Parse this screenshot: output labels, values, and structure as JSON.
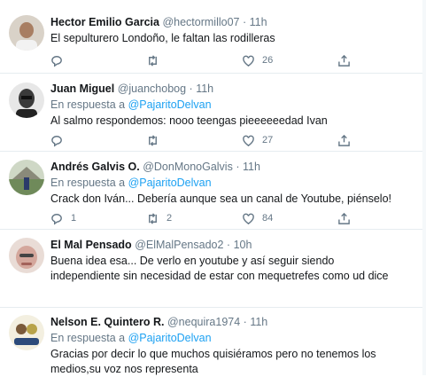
{
  "tweets": [
    {
      "name": "Hector Emilio Garcia",
      "handle": "@hectormillo07",
      "time": "11h",
      "reply_prefix": "",
      "reply_to": "",
      "text": "El sepulturero Londoño, le faltan las rodilleras",
      "replies": "",
      "retweets": "",
      "likes": "26",
      "avatar_color": "#8a7b6a"
    },
    {
      "name": "Juan Miguel",
      "handle": "@juanchobog",
      "time": "11h",
      "reply_prefix": "En respuesta a",
      "reply_to": "@PajaritoDelvan",
      "text": "Al salmo respondemos: nooo teengas pieeeeeedad Ivan",
      "replies": "",
      "retweets": "",
      "likes": "27",
      "avatar_color": "#2b2b2b"
    },
    {
      "name": "Andrés Galvis O.",
      "handle": "@DonMonoGalvis",
      "time": "11h",
      "reply_prefix": "En respuesta a",
      "reply_to": "@PajaritoDelvan",
      "text": "Crack don Iván... Debería aunque sea un canal de Youtube, piénselo!",
      "replies": "1",
      "retweets": "2",
      "likes": "84",
      "avatar_color": "#6f8a5a"
    },
    {
      "name": "El Mal Pensado",
      "handle": "@ElMalPensado2",
      "time": "10h",
      "reply_prefix": "",
      "reply_to": "",
      "text": "Buena idea esa... De verlo en youtube y así seguir siendo independiente sin necesidad de estar con mequetrefes como ud dice",
      "replies": "",
      "retweets": "",
      "likes": "",
      "avatar_color": "#c9a3a0"
    },
    {
      "name": "Nelson E. Quintero R.",
      "handle": "@nequira1974",
      "time": "11h",
      "reply_prefix": "En respuesta a",
      "reply_to": "@PajaritoDelvan",
      "text": "Gracias por decir lo que muchos quisiéramos pero no tenemos los medios,su voz nos representa",
      "replies": "",
      "retweets": "",
      "likes": "",
      "avatar_color": "#b8a34a"
    }
  ],
  "icons": {
    "reply": "reply-icon",
    "retweet": "retweet-icon",
    "like": "heart-icon",
    "share": "share-icon"
  },
  "colors": {
    "link": "#1da1f2",
    "muted": "#657786",
    "text": "#14171a",
    "divider": "#e6ecf0"
  }
}
